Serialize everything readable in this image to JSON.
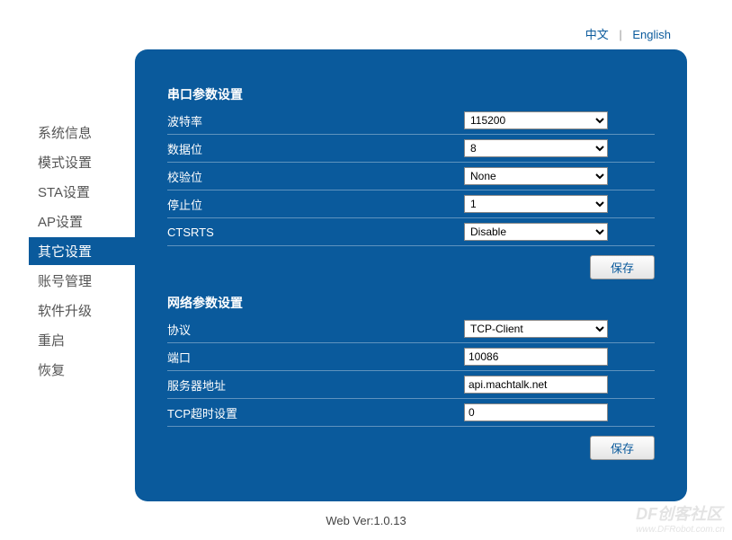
{
  "lang": {
    "zh": "中文",
    "en": "English"
  },
  "sidebar": {
    "items": [
      {
        "label": "系统信息"
      },
      {
        "label": "模式设置"
      },
      {
        "label": "STA设置"
      },
      {
        "label": "AP设置"
      },
      {
        "label": "其它设置"
      },
      {
        "label": "账号管理"
      },
      {
        "label": "软件升级"
      },
      {
        "label": "重启"
      },
      {
        "label": "恢复"
      }
    ],
    "activeIndex": 4
  },
  "serial": {
    "title": "串口参数设置",
    "baud": {
      "label": "波特率",
      "value": "115200"
    },
    "databits": {
      "label": "数据位",
      "value": "8"
    },
    "parity": {
      "label": "校验位",
      "value": "None"
    },
    "stopbits": {
      "label": "停止位",
      "value": "1"
    },
    "ctsrts": {
      "label": "CTSRTS",
      "value": "Disable"
    },
    "save": "保存"
  },
  "net": {
    "title": "网络参数设置",
    "protocol": {
      "label": "协议",
      "value": "TCP-Client"
    },
    "port": {
      "label": "端口",
      "value": "10086"
    },
    "server": {
      "label": "服务器地址",
      "value": "api.machtalk.net"
    },
    "timeout": {
      "label": "TCP超时设置",
      "value": "0"
    },
    "save": "保存"
  },
  "footer": "Web Ver:1.0.13",
  "watermark": {
    "main": "DF创客社区",
    "sub": "www.DFRobot.com.cn"
  }
}
